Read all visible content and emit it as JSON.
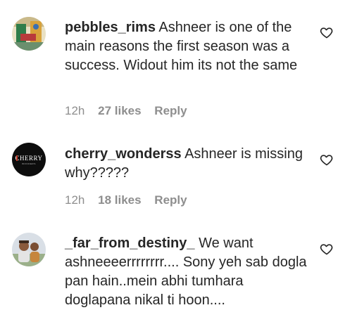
{
  "comments": [
    {
      "username": "pebbles_rims",
      "text": "Ashneer is one of the main reasons the first season was a success. Widout him its not the same",
      "time": "12h",
      "likes": "27 likes",
      "reply": "Reply",
      "icon": "heart-outline-icon"
    },
    {
      "username": "cherry_wonderss",
      "text": "Ashneer is missing why?????",
      "time": "12h",
      "likes": "18 likes",
      "reply": "Reply",
      "icon": "heart-outline-icon"
    },
    {
      "username": "_far_from_destiny_",
      "text": "We want ashneeeerrrrrrrr.... Sony yeh sab dogla pan hain..mein abhi tumhara doglapana nikal ti hoon....",
      "icon": "heart-outline-icon"
    }
  ],
  "avatar_logo": {
    "brand": "CHERRY",
    "tagline": "WONDERS"
  },
  "colors": {
    "text": "#262626",
    "secondary": "#8e8e8e",
    "background": "#ffffff"
  }
}
